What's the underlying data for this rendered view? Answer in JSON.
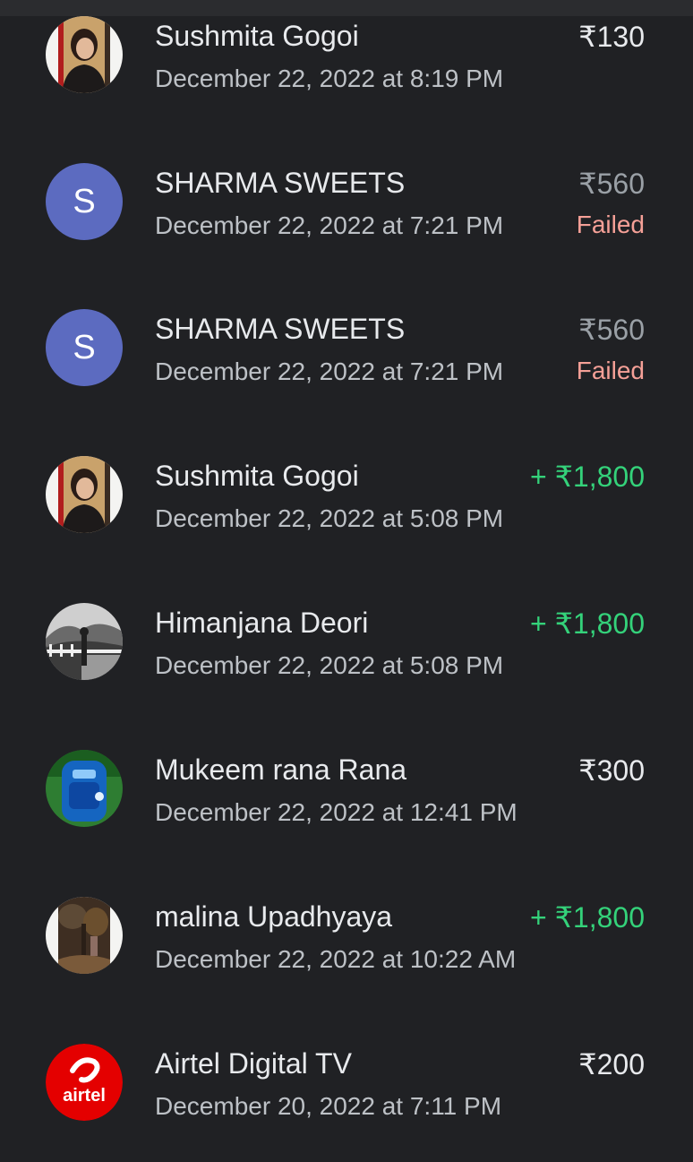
{
  "transactions": [
    {
      "name": "Sushmita Gogoi",
      "date": "December 22, 2022 at 8:19 PM",
      "amount": "₹130",
      "status": "",
      "avatar": "photo-person"
    },
    {
      "name": "SHARMA SWEETS",
      "date": "December 22, 2022 at 7:21 PM",
      "amount": "₹560",
      "status": "Failed",
      "avatar": "letter",
      "letter": "S"
    },
    {
      "name": "SHARMA SWEETS",
      "date": "December 22, 2022 at 7:21 PM",
      "amount": "₹560",
      "status": "Failed",
      "avatar": "letter",
      "letter": "S"
    },
    {
      "name": "Sushmita Gogoi",
      "date": "December 22, 2022 at 5:08 PM",
      "amount": "+ ₹1,800",
      "status": "",
      "avatar": "photo-person"
    },
    {
      "name": "Himanjana Deori",
      "date": "December 22, 2022 at 5:08 PM",
      "amount": "+ ₹1,800",
      "status": "",
      "avatar": "photo-landscape"
    },
    {
      "name": "Mukeem rana Rana",
      "date": "December 22, 2022 at 12:41 PM",
      "amount": "₹300",
      "status": "",
      "avatar": "photo-backpack"
    },
    {
      "name": "malina Upadhyaya",
      "date": "December 22, 2022 at 10:22 AM",
      "amount": "+ ₹1,800",
      "status": "",
      "avatar": "photo-forest"
    },
    {
      "name": "Airtel Digital TV",
      "date": "December 20, 2022 at 7:11 PM",
      "amount": "₹200",
      "status": "",
      "avatar": "airtel-logo",
      "logo_text": "airtel"
    }
  ],
  "colors": {
    "background": "#202124",
    "primary_text": "#e8eaed",
    "secondary_text": "#bdc1c6",
    "credit": "#34d27a",
    "failed": "#f5a097",
    "letter_avatar": "#5c6bc0",
    "airtel": "#e40000"
  }
}
